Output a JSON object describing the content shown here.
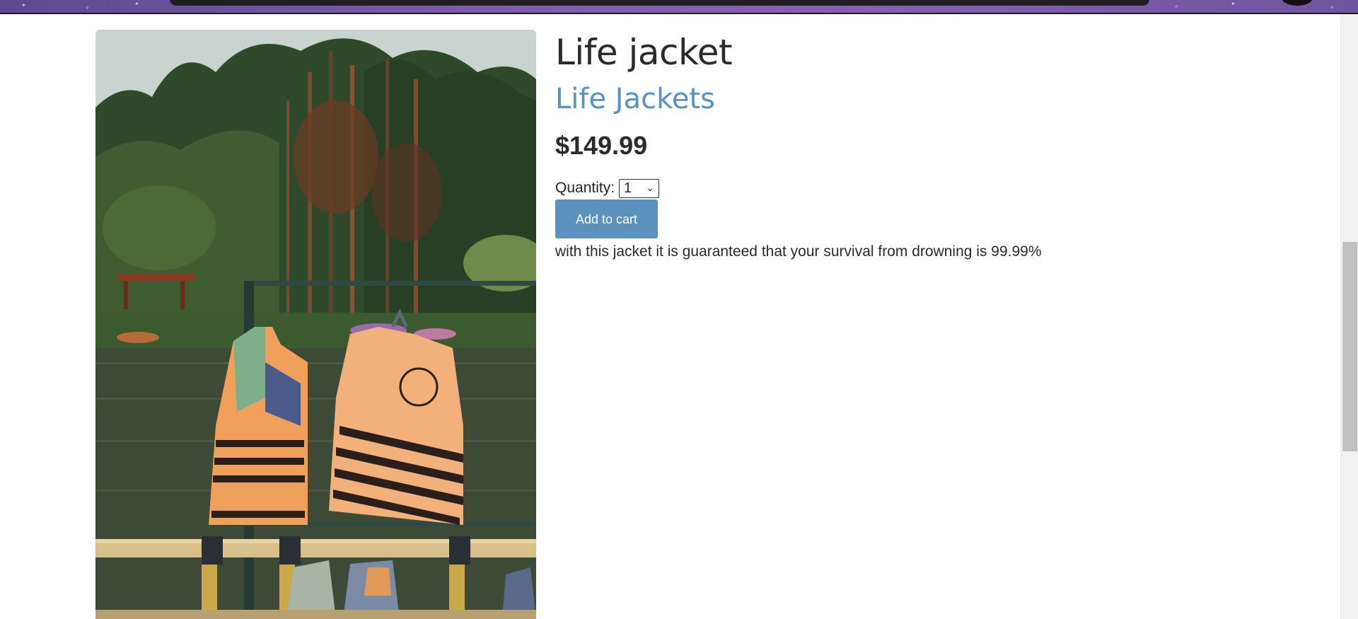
{
  "product": {
    "title": "Life jacket",
    "category": "Life Jackets",
    "price": "$149.99",
    "quantity_label": "Quantity:",
    "quantity_value": "1",
    "add_to_cart_label": "Add to cart",
    "description": "with this jacket it is guaranteed that your survival from drowning is 99.99%"
  },
  "colors": {
    "accent": "#5b92bd",
    "text": "#2b2b2b",
    "banner": "#7a5aa8"
  },
  "icons": {
    "select_chevron": "chevron-down-icon"
  }
}
